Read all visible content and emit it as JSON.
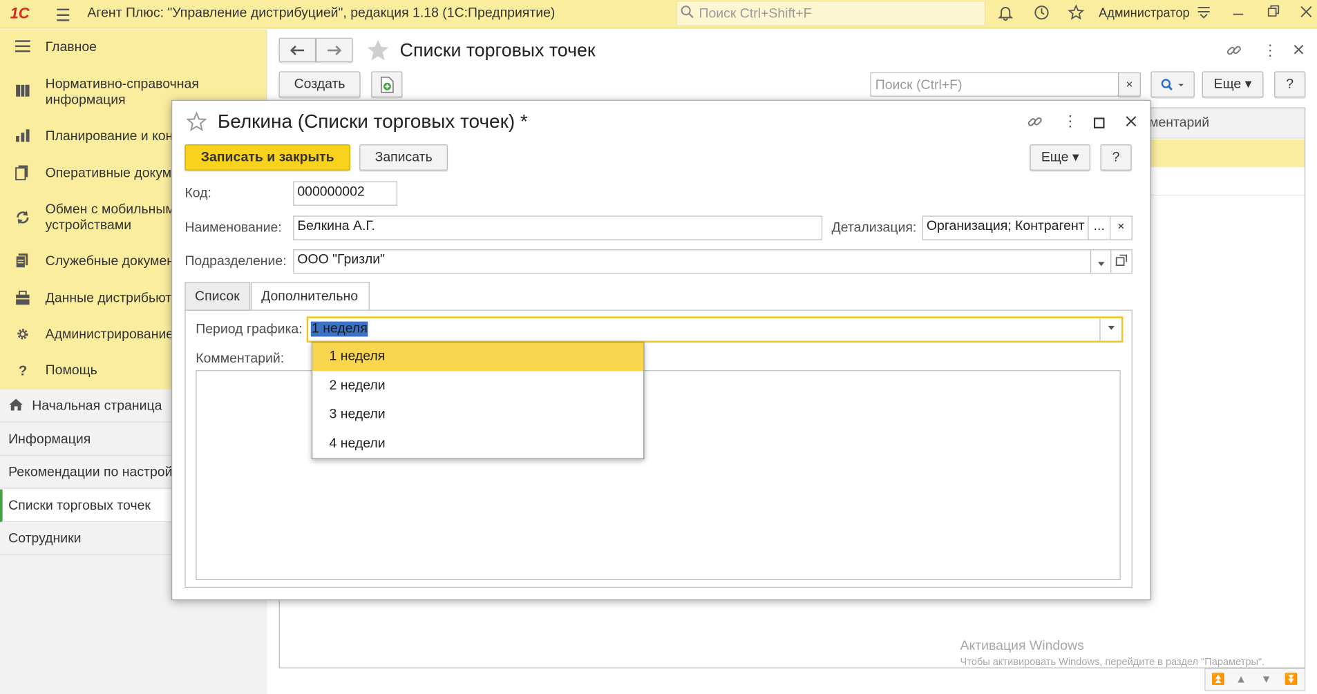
{
  "app": {
    "logo": "1С",
    "title": "Агент Плюс: \"Управление дистрибуцией\", редакция 1.18  (1С:Предприятие)",
    "search_placeholder": "Поиск Ctrl+Shift+F",
    "user": "Администратор"
  },
  "sidebar": {
    "items": [
      {
        "icon": "menu-lines-icon",
        "label": "Главное"
      },
      {
        "icon": "book-icon",
        "label": "Нормативно-справочная информация"
      },
      {
        "icon": "bar-chart-icon",
        "label": "Планирование и кон"
      },
      {
        "icon": "documents-icon",
        "label": "Оперативные докум"
      },
      {
        "icon": "sync-icon",
        "label": "Обмен с мобильными устройствами"
      },
      {
        "icon": "service-docs-icon",
        "label": "Служебные докумен"
      },
      {
        "icon": "distributor-icon",
        "label": "Данные дистрибьют"
      },
      {
        "icon": "gear-icon",
        "label": "Администрирование"
      },
      {
        "icon": "question-icon",
        "label": "Помощь"
      }
    ],
    "lower": [
      {
        "label": "Начальная страница"
      },
      {
        "label": "Информация"
      },
      {
        "label": "Рекомендации по настрой"
      },
      {
        "label": "Списки торговых точек"
      },
      {
        "label": "Сотрудники"
      }
    ]
  },
  "main": {
    "title": "Списки торговых точек",
    "create_label": "Создать",
    "search_placeholder": "Поиск (Ctrl+F)",
    "more_label": "Еще",
    "help_label": "?",
    "column_fragment": "ментарий",
    "activation_title": "Активация Windows",
    "activation_text": "Чтобы активировать Windows, перейдите в раздел \"Параметры\"."
  },
  "dialog": {
    "title": "Белкина (Списки торговых точек) *",
    "save_close_label": "Записать и закрыть",
    "save_label": "Записать",
    "more_label": "Еще",
    "help_label": "?",
    "code_label": "Код:",
    "code_value": "000000002",
    "name_label": "Наименование:",
    "name_value": "Белкина А.Г.",
    "detail_label": "Детализация:",
    "detail_value": "Организация; Контрагент",
    "detail_more": "...",
    "dept_label": "Подразделение:",
    "dept_value": "ООО \"Гризли\"",
    "tabs": [
      {
        "label": "Список"
      },
      {
        "label": "Дополнительно"
      }
    ],
    "period_label": "Период графика:",
    "period_value": "1 неделя",
    "comment_label": "Комментарий:",
    "period_options": [
      "1 неделя",
      "2 недели",
      "3 недели",
      "4 недели"
    ]
  }
}
